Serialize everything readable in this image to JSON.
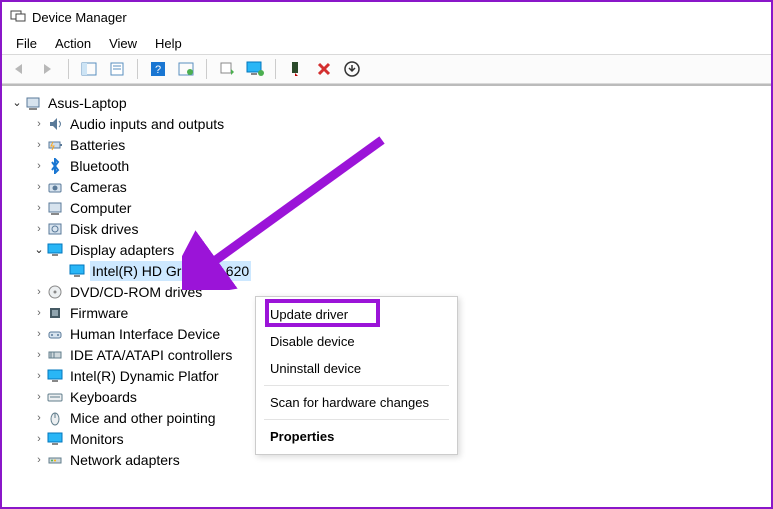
{
  "title": "Device Manager",
  "menu": {
    "file": "File",
    "action": "Action",
    "view": "View",
    "help": "Help"
  },
  "root": "Asus-Laptop",
  "nodes": [
    {
      "label": "Audio inputs and outputs",
      "icon": "audio"
    },
    {
      "label": "Batteries",
      "icon": "battery"
    },
    {
      "label": "Bluetooth",
      "icon": "bt"
    },
    {
      "label": "Cameras",
      "icon": "cam"
    },
    {
      "label": "Computer",
      "icon": "pc"
    },
    {
      "label": "Disk drives",
      "icon": "disk"
    },
    {
      "label": "Display adapters",
      "icon": "display",
      "expanded": true,
      "children": [
        {
          "label": "Intel(R) HD Graphics 620",
          "icon": "display",
          "selected": true
        }
      ]
    },
    {
      "label": "DVD/CD-ROM drives",
      "icon": "dvd"
    },
    {
      "label": "Firmware",
      "icon": "fw"
    },
    {
      "label": "Human Interface Devices",
      "icon": "hid",
      "trunc": "Human Interface Device"
    },
    {
      "label": "IDE ATA/ATAPI controllers",
      "icon": "ide",
      "trunc": "IDE ATA/ATAPI controllers"
    },
    {
      "label": "Intel(R) Dynamic Platform",
      "icon": "intel",
      "trunc": "Intel(R) Dynamic Platfor"
    },
    {
      "label": "Keyboards",
      "icon": "kb"
    },
    {
      "label": "Mice and other pointing",
      "icon": "mouse",
      "trunc": "Mice and other pointing"
    },
    {
      "label": "Monitors",
      "icon": "mon"
    },
    {
      "label": "Network adapters",
      "icon": "net"
    }
  ],
  "context": {
    "update": "Update driver",
    "disable": "Disable device",
    "uninstall": "Uninstall device",
    "scan": "Scan for hardware changes",
    "props": "Properties"
  }
}
